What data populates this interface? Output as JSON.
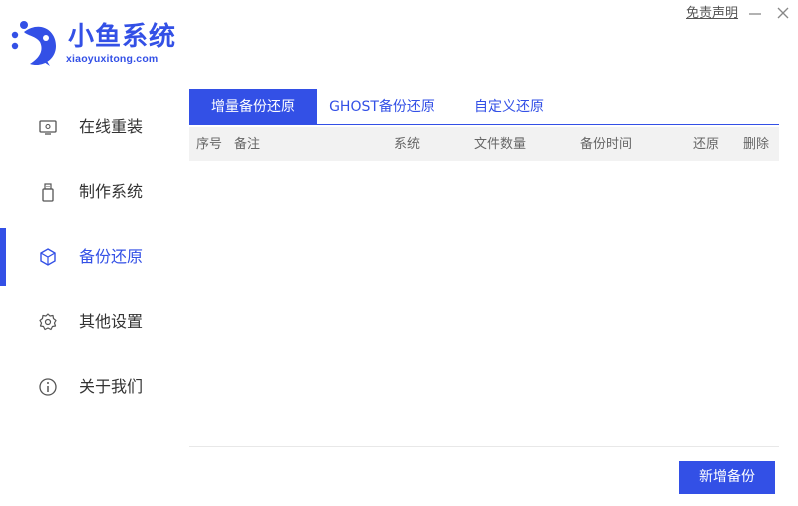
{
  "app": {
    "logo_title": "小鱼系统",
    "logo_subtitle": "xiaoyuxitong.com",
    "brand_color": "#3350e6"
  },
  "titlebar": {
    "disclaimer": "免责声明",
    "minimize_icon": "minus-icon",
    "close_icon": "close-icon"
  },
  "sidebar": {
    "items": [
      {
        "label": "在线重装",
        "icon": "monitor-icon",
        "active": false
      },
      {
        "label": "制作系统",
        "icon": "usb-drive-icon",
        "active": false
      },
      {
        "label": "备份还原",
        "icon": "backup-cube-icon",
        "active": true
      },
      {
        "label": "其他设置",
        "icon": "gear-icon",
        "active": false
      },
      {
        "label": "关于我们",
        "icon": "info-icon",
        "active": false
      }
    ]
  },
  "tabs": [
    {
      "label": "增量备份还原",
      "active": true
    },
    {
      "label": "GHOST备份还原",
      "active": false
    },
    {
      "label": "自定义还原",
      "active": false
    }
  ],
  "table": {
    "columns": [
      "序号",
      "备注",
      "系统",
      "文件数量",
      "备份时间",
      "还原",
      "删除"
    ],
    "rows": []
  },
  "actions": {
    "new_backup": "新增备份"
  }
}
